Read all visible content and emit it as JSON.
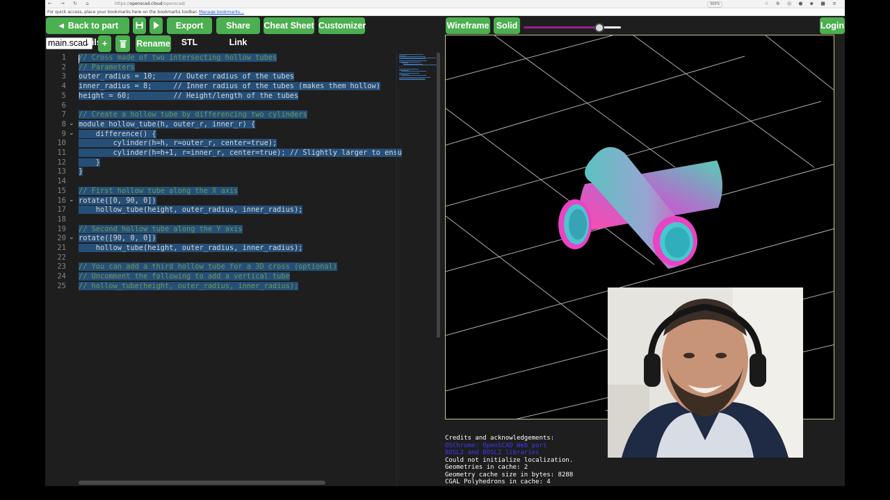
{
  "browser": {
    "url_host": "openscad.cloud",
    "url_path": "/openscad/",
    "url_prefix": "https://",
    "zoom": "300%",
    "bookmarks_hint": "For quick access, place your bookmarks here on the bookmarks toolbar.",
    "bookmarks_link": "Manage bookmarks…"
  },
  "toolbar": {
    "back_label": "◄ Back to part details",
    "save_icon": "floppy-disk",
    "run_icon": "play",
    "export_label": "Export STL",
    "share_label": "Share Link",
    "cheatsheet_label": "Cheat Sheet",
    "customizer_label": "Customizer",
    "add_label": "+",
    "rename_label": "Rename",
    "wireframe_label": "Wireframe",
    "solid_label": "Solid",
    "login_label": "Login"
  },
  "file_select": {
    "value": "main.scad"
  },
  "zoom_slider": {
    "value": 0.78
  },
  "editor": {
    "line_numbers": [
      "1",
      "2",
      "3",
      "4",
      "5",
      "6",
      "7",
      "8",
      "9",
      "10",
      "11",
      "12",
      "13",
      "14",
      "15",
      "16",
      "17",
      "18",
      "19",
      "20",
      "21",
      "22",
      "23",
      "24",
      "25"
    ],
    "lines": [
      "// Cross made of two intersecting hollow tubes",
      "// Parameters",
      "outer_radius = 10;    // Outer radius of the tubes",
      "inner_radius = 8;     // Inner radius of the tubes (makes them hollow)",
      "height = 60;          // Height/length of the tubes",
      "",
      "// Create a hollow tube by differencing two cylinders",
      "module hollow_tube(h, outer_r, inner_r) {",
      "    difference() {",
      "        cylinder(h=h, r=outer_r, center=true);",
      "        cylinder(h=h+1, r=inner_r, center=true); // Slightly larger to ensu",
      "    }",
      "}",
      "",
      "// First hollow tube along the X axis",
      "rotate([0, 90, 0])",
      "    hollow_tube(height, outer_radius, inner_radius);",
      "",
      "// Second hollow tube along the Y axis",
      "rotate([90, 0, 0])",
      "    hollow_tube(height, outer_radius, inner_radius);",
      "",
      "// You can add a third hollow tube for a 3D cross (optional)",
      "// Uncomment the following to add a vertical tube",
      "// hollow_tube(height, outer_radius, inner_radius);"
    ]
  },
  "console": {
    "lines": [
      "Credits and acknowledgements:",
      "OSChrome: OpenSCAD Web port",
      "BOSL2 and BOSL2 libraries",
      "Could not initialize localization.",
      "Geometries in cache: 2",
      "Geometry cache size in bytes: 8288",
      "CGAL Polyhedrons in cache: 4"
    ]
  }
}
